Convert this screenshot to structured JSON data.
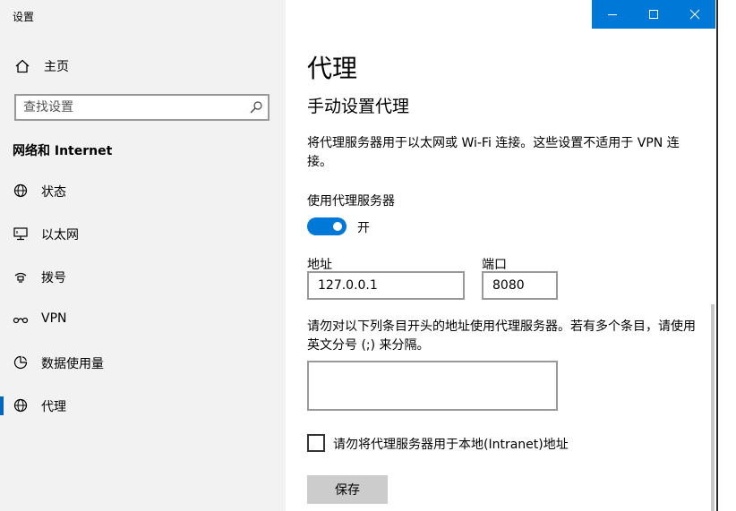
{
  "window": {
    "title": "设置",
    "controls": {
      "minimize": "minimize-icon",
      "maximize": "maximize-icon",
      "close": "close-icon"
    }
  },
  "sidebar": {
    "home_label": "主页",
    "search_placeholder": "查找设置",
    "section_title": "网络和 Internet",
    "items": [
      {
        "label": "状态",
        "icon": "globe-icon"
      },
      {
        "label": "以太网",
        "icon": "ethernet-icon"
      },
      {
        "label": "拨号",
        "icon": "dialup-icon"
      },
      {
        "label": "VPN",
        "icon": "vpn-icon"
      },
      {
        "label": "数据使用量",
        "icon": "data-usage-icon"
      },
      {
        "label": "代理",
        "icon": "globe-icon",
        "active": true
      }
    ]
  },
  "main": {
    "title": "代理",
    "subtitle": "手动设置代理",
    "description": "将代理服务器用于以太网或 Wi-Fi 连接。这些设置不适用于 VPN 连接。",
    "use_proxy_label": "使用代理服务器",
    "toggle_state": "开",
    "address_label": "地址",
    "address_value": "127.0.0.1",
    "port_label": "端口",
    "port_value": "8080",
    "exceptions_description": "请勿对以下列条目开头的地址使用代理服务器。若有多个条目，请使用英文分号 (;) 来分隔。",
    "exceptions_value": "",
    "local_checkbox_label": "请勿将代理服务器用于本地(Intranet)地址",
    "local_checkbox_checked": false,
    "save_label": "保存"
  },
  "colors": {
    "accent": "#0078d7",
    "sidebar_bg": "#f2f2f2",
    "button_bg": "#cccccc"
  }
}
